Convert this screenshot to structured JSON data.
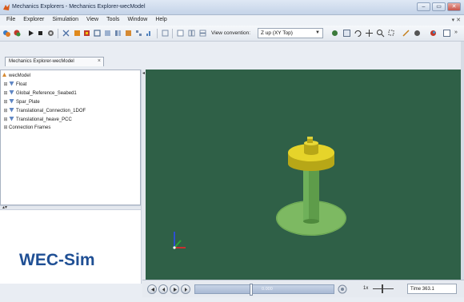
{
  "window": {
    "title": "Mechanics Explorers - Mechanics Explorer-wecModel",
    "buttons": {
      "minimize": "–",
      "maximize": "▭",
      "close": "✕"
    }
  },
  "menu": {
    "items": [
      "File",
      "Explorer",
      "Simulation",
      "View",
      "Tools",
      "Window",
      "Help"
    ],
    "right_glyphs": "▾ ✕"
  },
  "toolbar": {
    "view_convention_label": "View convention:",
    "view_convention_value": "Z up (XY Top)"
  },
  "doc_tab": {
    "label": "Mechanics Explorer-wecModel",
    "close": "×"
  },
  "tree": {
    "root": "wecModel",
    "items": [
      "Float",
      "Global_Reference_Seabed1",
      "Spar_Plate",
      "Translational_Connection_1DOF",
      "Translational_heave_PCC"
    ],
    "footer_item": "Connection Frames"
  },
  "logo": {
    "text": "WEC-Sim"
  },
  "playback": {
    "progress_label": "0.000",
    "progress_fraction": 0.4,
    "speed_value": "1x",
    "time_label": "Time 363.1"
  },
  "colors": {
    "viewport_bg": "#2f6047",
    "float": "#e0d023",
    "plate": "#79b35e",
    "spar": "#5e9c4a",
    "logo": "#1f4f94"
  },
  "icons": {
    "triad": "axis-triad-icon",
    "app": "matlab-icon"
  }
}
